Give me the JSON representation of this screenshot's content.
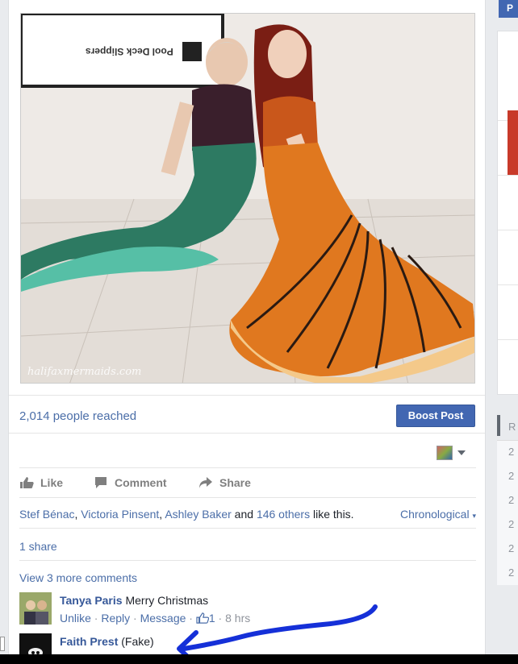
{
  "post": {
    "photo_watermark": "halifaxmermaids.com",
    "photo_sign_text": "Pool Deck Slippers",
    "reach_text": "2,014 people reached",
    "boost_label": "Boost Post"
  },
  "actions": {
    "like": "Like",
    "comment": "Comment",
    "share": "Share"
  },
  "likes": {
    "name1": "Stef Bénac",
    "sep1": ", ",
    "name2": "Victoria Pinsent",
    "sep2": ", ",
    "name3": "Ashley Baker",
    "and": " and ",
    "others": "146 others",
    "suffix": " like this.",
    "sort_label": "Chronological"
  },
  "shares": {
    "count_text": "1 share"
  },
  "comments": {
    "view_more": "View 3 more comments",
    "items": [
      {
        "name": "Tanya Paris",
        "text": "Merry Christmas",
        "unlike": "Unlike",
        "reply": "Reply",
        "message": "Message",
        "like_count": "1",
        "time": "8 hrs"
      },
      {
        "name": "Faith Prest",
        "text": "(Fake)"
      }
    ]
  },
  "right_column": {
    "button_letter": "P",
    "section_letter": "R",
    "years": [
      "2",
      "2",
      "2",
      "2",
      "2",
      "2"
    ]
  },
  "colors": {
    "link": "#4b6ea8",
    "name": "#365899",
    "boost": "#4267b2",
    "annotation": "#1530d8"
  }
}
